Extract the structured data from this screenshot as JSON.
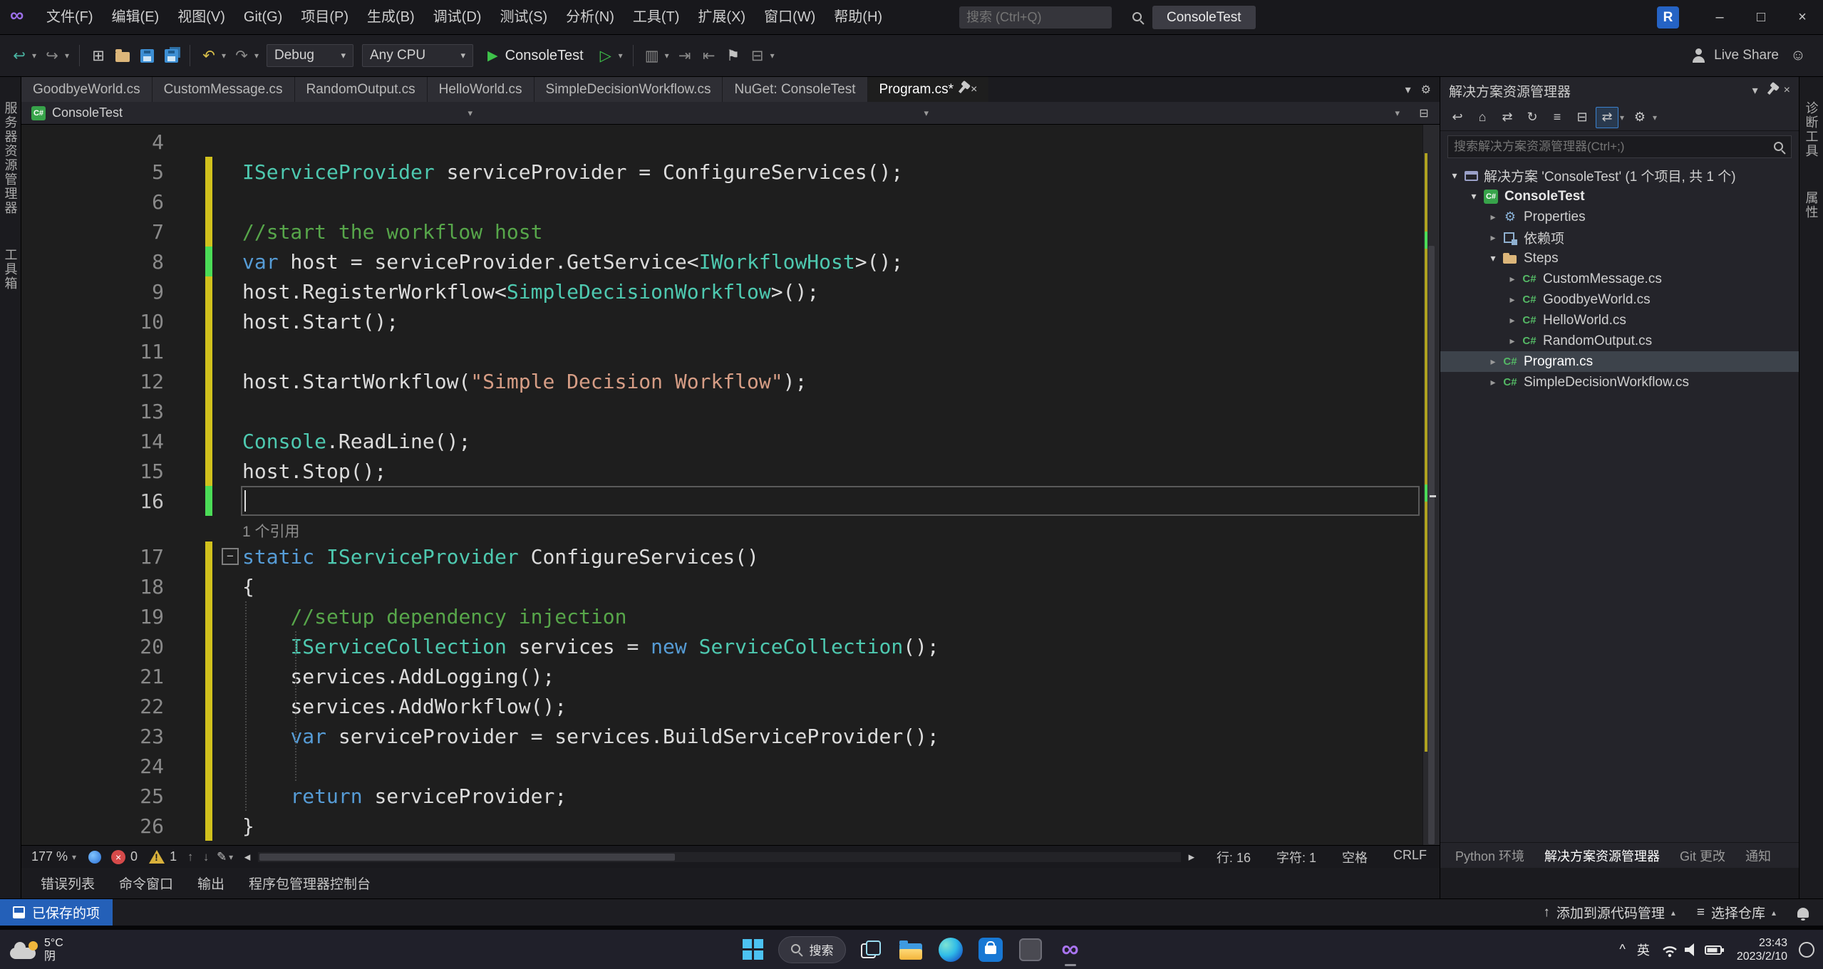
{
  "colors": {
    "keyword": "#569cd6",
    "type": "#4ec9b0",
    "string": "#d69d85",
    "comment": "#57a64a",
    "plain": "#dcdcdc",
    "linenum": "#8a8a8a",
    "chgy": "#d1c11d",
    "chgg": "#4bdc57",
    "accent": "#007acc",
    "rungreen": "#3ec24a",
    "statusblue": "#2460b8",
    "selbg": "#3d434b"
  },
  "icons": {
    "csharp": "C#",
    "close": "×",
    "caret-down": "▾",
    "triangle-up": "▴",
    "nav-back": "↩",
    "nav-forward": "↪",
    "undo": "↶",
    "redo": "↷",
    "run": "▶",
    "run-outline": "▷",
    "new-file": "⊞",
    "bookmark": "⚑",
    "gear": "⚙",
    "home": "⌂",
    "swap": "⇄",
    "refresh": "↻",
    "collapse-all": "⊟",
    "levels": "≡",
    "columns": "▥",
    "indent": "⇥",
    "outdent": "⇤",
    "expanded": "▾",
    "collapsed": "▸",
    "minimize": "–",
    "maximize": "□",
    "infinity": "∞",
    "smiley": "☺",
    "arrow-up": "↑",
    "arrow-down": "↓",
    "pencil": "✎",
    "tri-left": "◂",
    "tri-right": "▸",
    "chevron-up": "^"
  },
  "titlebar": {
    "menus": [
      "文件(F)",
      "编辑(E)",
      "视图(V)",
      "Git(G)",
      "项目(P)",
      "生成(B)",
      "调试(D)",
      "测试(S)",
      "分析(N)",
      "工具(T)",
      "扩展(X)",
      "窗口(W)",
      "帮助(H)"
    ],
    "search_placeholder": "搜索 (Ctrl+Q)",
    "solution_badge": "ConsoleTest",
    "account_initial": "R"
  },
  "toolbar": {
    "config": "Debug",
    "platform": "Any CPU",
    "run_target": "ConsoleTest",
    "live_share": "Live Share"
  },
  "doc_tabs": [
    {
      "label": "GoodbyeWorld.cs"
    },
    {
      "label": "CustomMessage.cs"
    },
    {
      "label": "RandomOutput.cs"
    },
    {
      "label": "HelloWorld.cs"
    },
    {
      "label": "SimpleDecisionWorkflow.cs"
    },
    {
      "label": "NuGet: ConsoleTest"
    },
    {
      "label": "Program.cs*",
      "active": true
    }
  ],
  "breadcrumb": {
    "project": "ConsoleTest"
  },
  "left_strip": [
    "服务器资源管理器",
    "工具箱"
  ],
  "right_strip": [
    "诊断工具",
    "属性"
  ],
  "editor": {
    "lines": [
      {
        "n": 4,
        "t": []
      },
      {
        "n": 5,
        "chg": "y",
        "t": [
          [
            "t",
            "IServiceProvider"
          ],
          [
            "p",
            " serviceProvider = ConfigureServices();"
          ]
        ]
      },
      {
        "n": 6,
        "chg": "y",
        "t": []
      },
      {
        "n": 7,
        "chg": "y",
        "t": [
          [
            "c",
            "//start the workflow host"
          ]
        ]
      },
      {
        "n": 8,
        "chg": "g",
        "t": [
          [
            "k",
            "var"
          ],
          [
            "p",
            " host = serviceProvider.GetService<"
          ],
          [
            "t",
            "IWorkflowHost"
          ],
          [
            "p",
            ">();"
          ]
        ]
      },
      {
        "n": 9,
        "chg": "y",
        "t": [
          [
            "p",
            "host.RegisterWorkflow<"
          ],
          [
            "t",
            "SimpleDecisionWorkflow"
          ],
          [
            "p",
            ">();"
          ]
        ]
      },
      {
        "n": 10,
        "chg": "y",
        "t": [
          [
            "p",
            "host.Start();"
          ]
        ]
      },
      {
        "n": 11,
        "chg": "y",
        "t": []
      },
      {
        "n": 12,
        "chg": "y",
        "t": [
          [
            "p",
            "host.StartWorkflow("
          ],
          [
            "s",
            "\"Simple Decision Workflow\""
          ],
          [
            "p",
            ");"
          ]
        ]
      },
      {
        "n": 13,
        "chg": "y",
        "t": []
      },
      {
        "n": 14,
        "chg": "y",
        "t": [
          [
            "t",
            "Console"
          ],
          [
            "p",
            ".ReadLine();"
          ]
        ]
      },
      {
        "n": 15,
        "chg": "y",
        "t": [
          [
            "p",
            "host.Stop();"
          ]
        ]
      },
      {
        "n": 16,
        "chg": "g",
        "cur": true,
        "t": []
      },
      {
        "n": 17,
        "chg": "y",
        "lens": "1 个引用",
        "fold": true,
        "t": [
          [
            "k",
            "static"
          ],
          [
            "p",
            " "
          ],
          [
            "t",
            "IServiceProvider"
          ],
          [
            "p",
            " ConfigureServices()"
          ]
        ]
      },
      {
        "n": 18,
        "chg": "y",
        "t": [
          [
            "p",
            "{"
          ]
        ]
      },
      {
        "n": 19,
        "chg": "y",
        "t": [
          [
            "p",
            "    "
          ],
          [
            "c",
            "//setup dependency injection"
          ]
        ]
      },
      {
        "n": 20,
        "chg": "y",
        "t": [
          [
            "p",
            "    "
          ],
          [
            "t",
            "IServiceCollection"
          ],
          [
            "p",
            " services = "
          ],
          [
            "k",
            "new"
          ],
          [
            "p",
            " "
          ],
          [
            "t",
            "ServiceCollection"
          ],
          [
            "p",
            "();"
          ]
        ]
      },
      {
        "n": 21,
        "chg": "y",
        "t": [
          [
            "p",
            "    services.AddLogging();"
          ]
        ]
      },
      {
        "n": 22,
        "chg": "y",
        "t": [
          [
            "p",
            "    services.AddWorkflow();"
          ]
        ]
      },
      {
        "n": 23,
        "chg": "y",
        "t": [
          [
            "p",
            "    "
          ],
          [
            "k",
            "var"
          ],
          [
            "p",
            " serviceProvider = services.BuildServiceProvider();"
          ]
        ]
      },
      {
        "n": 24,
        "chg": "y",
        "t": []
      },
      {
        "n": 25,
        "chg": "y",
        "t": [
          [
            "p",
            "    "
          ],
          [
            "k",
            "return"
          ],
          [
            "p",
            " serviceProvider;"
          ]
        ]
      },
      {
        "n": 26,
        "chg": "y",
        "t": [
          [
            "p",
            "}"
          ]
        ]
      }
    ],
    "status": {
      "zoom": "177 %",
      "errors": "0",
      "warnings": "1",
      "line": "行: 16",
      "column": "字符: 1",
      "spaces": "空格",
      "encoding": "CRLF"
    }
  },
  "panel_tabs": [
    "错误列表",
    "命令窗口",
    "输出",
    "程序包管理器控制台"
  ],
  "solution_explorer": {
    "title": "解决方案资源管理器",
    "search_placeholder": "搜索解决方案资源管理器(Ctrl+;)",
    "tree": [
      {
        "indent": 0,
        "exp": true,
        "icon": "solution",
        "label": "解决方案 'ConsoleTest' (1 个项目, 共 1 个)"
      },
      {
        "indent": 1,
        "exp": true,
        "icon": "project",
        "label": "ConsoleTest",
        "bold": true
      },
      {
        "indent": 2,
        "exp": false,
        "icon": "properties",
        "label": "Properties"
      },
      {
        "indent": 2,
        "exp": false,
        "icon": "deps",
        "label": "依赖项"
      },
      {
        "indent": 2,
        "exp": true,
        "icon": "folder",
        "label": "Steps"
      },
      {
        "indent": 3,
        "exp": false,
        "icon": "cs",
        "label": "CustomMessage.cs"
      },
      {
        "indent": 3,
        "exp": false,
        "icon": "cs",
        "label": "GoodbyeWorld.cs"
      },
      {
        "indent": 3,
        "exp": false,
        "icon": "cs",
        "label": "HelloWorld.cs"
      },
      {
        "indent": 3,
        "exp": false,
        "icon": "cs",
        "label": "RandomOutput.cs"
      },
      {
        "indent": 2,
        "exp": false,
        "icon": "cs",
        "label": "Program.cs",
        "selected": true
      },
      {
        "indent": 2,
        "exp": false,
        "icon": "cs",
        "label": "SimpleDecisionWorkflow.cs"
      }
    ],
    "bottom_tabs": [
      {
        "label": "Python 环境"
      },
      {
        "label": "解决方案资源管理器",
        "active": true
      },
      {
        "label": "Git 更改"
      },
      {
        "label": "通知"
      }
    ]
  },
  "statusbar": {
    "saved": "已保存的项",
    "add_scm": "添加到源代码管理",
    "select_repo": "选择仓库"
  },
  "taskbar": {
    "weather_temp": "5°C",
    "weather_cond": "阴",
    "search_label": "搜索",
    "ime": "英",
    "time": "23:43",
    "date": "2023/2/10"
  }
}
